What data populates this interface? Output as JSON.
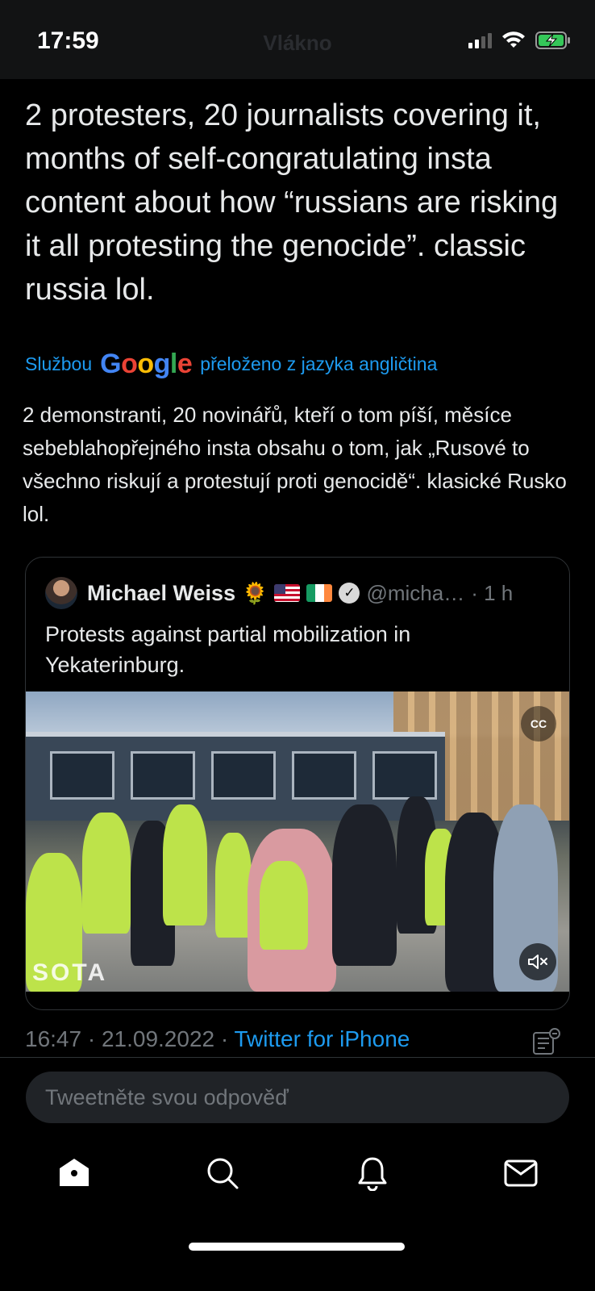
{
  "status_bar": {
    "time": "17:59",
    "ghost_title": "Vlákno",
    "icons": [
      "signal-icon",
      "wifi-icon",
      "battery-charging-icon"
    ]
  },
  "tweet": {
    "text": "2 protesters, 20 journalists covering it, months of self-congratulating insta content about how “russians are risking it all protesting the genocide”. classic russia lol.",
    "translated_by_prefix": "Službou",
    "translated_by_brand": "Google",
    "translated_by_suffix": "přeloženo z jazyka angličtina",
    "translation": "2 demonstranti, 20 novinářů, kteří o tom píší, měsíce sebeblahopřejného insta obsahu o tom, jak „Rusové to všechno riskují a protestují proti genocidě“. klasické Rusko lol.",
    "timestamp": "16:47 · 21.09.2022 · ",
    "source": "Twitter for iPhone"
  },
  "quote": {
    "author_name": "Michael Weiss",
    "emojis": [
      "🌻",
      "us-flag",
      "ireland-flag"
    ],
    "handle": "@micha…",
    "time": "· 1 h",
    "text": "Protests against partial mobilization in Yekaterinburg.",
    "media_watermark": "SOTA",
    "cc_label": "CC"
  },
  "compose": {
    "placeholder": "Tweetněte svou odpověď"
  },
  "tab_bar": {
    "items": [
      "home",
      "search",
      "notifications",
      "messages"
    ]
  },
  "colors": {
    "background": "#000000",
    "accent": "#1d9bf0",
    "text": "#e7e9ea",
    "muted": "#71767b"
  }
}
